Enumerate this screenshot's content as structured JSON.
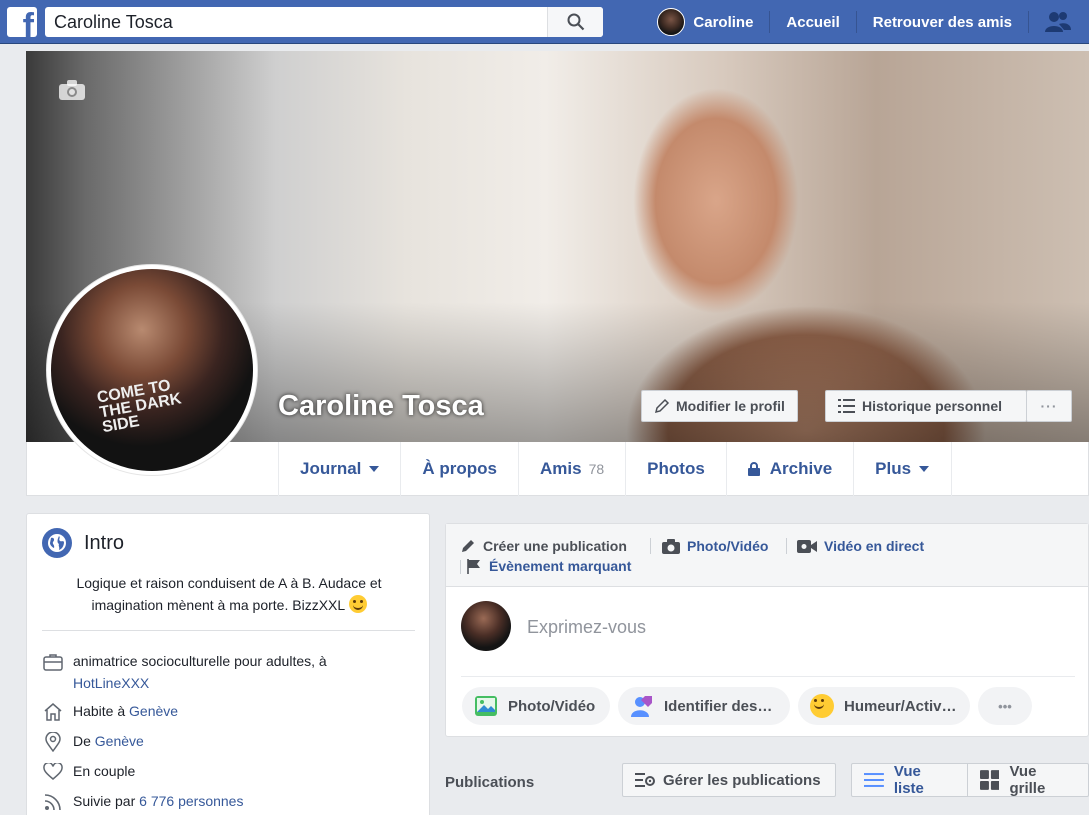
{
  "app": {
    "search_value": "Caroline Tosca",
    "nav": {
      "user": "Caroline",
      "home": "Accueil",
      "find_friends": "Retrouver des amis"
    }
  },
  "profile": {
    "name": "Caroline Tosca",
    "edit_profile": "Modifier le profil",
    "activity_log": "Historique personnel",
    "more_dots": "···",
    "shirt_text": "COME TO THE DARK SIDE"
  },
  "tabs": [
    {
      "label": "Journal",
      "has_caret": true
    },
    {
      "label": "À propos"
    },
    {
      "label": "Amis",
      "count": "78"
    },
    {
      "label": "Photos"
    },
    {
      "label": "Archive",
      "icon": "lock-icon"
    },
    {
      "label": "Plus",
      "has_caret": true
    }
  ],
  "intro": {
    "title": "Intro",
    "bio": "Logique et raison conduisent de A à B. Audace et imagination mènent à ma porte. BizzXXL",
    "work_text": "animatrice socioculturelle pour adultes, à",
    "work_link": "HotLineXXX",
    "lives_text": "Habite à",
    "lives_link": "Genève",
    "from_text": "De",
    "from_link": "Genève",
    "relationship": "En couple",
    "followed_text": "Suivie par",
    "followed_link": "6 776 personnes"
  },
  "composer": {
    "create_post": "Créer une publication",
    "photo_video": "Photo/Vidéo",
    "live_video": "Vidéo en direct",
    "life_event": "Évènement marquant",
    "placeholder": "Exprimez-vous",
    "actions": {
      "photo": "Photo/Vidéo",
      "tag": "Identifier des…",
      "feeling": "Humeur/Activ…",
      "more": "•••"
    }
  },
  "publications": {
    "label": "Publications",
    "manage": "Gérer les publications",
    "list_view": "Vue liste",
    "grid_view": "Vue grille"
  },
  "colors": {
    "brand": "#4267b2",
    "link": "#365899",
    "background": "#e9ebee"
  }
}
